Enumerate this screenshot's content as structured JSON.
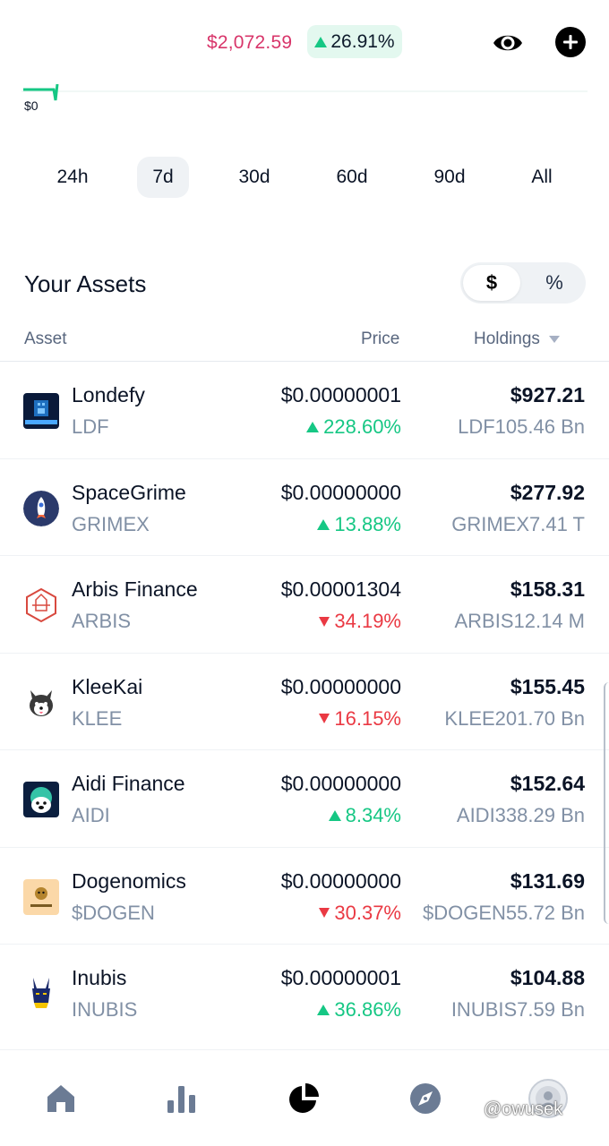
{
  "header": {
    "total_value": "$2,072.59",
    "change_percent": "26.91%",
    "change_direction": "up",
    "eye_icon": "eye-icon",
    "add_icon": "plus-circle-icon"
  },
  "chart": {
    "zero_label": "$0",
    "line_color": "#16c784"
  },
  "ranges": [
    "24h",
    "7d",
    "30d",
    "60d",
    "90d",
    "All"
  ],
  "active_range": "7d",
  "assets_section": {
    "title": "Your Assets",
    "toggle_dollar": "$",
    "toggle_percent": "%",
    "col_asset": "Asset",
    "col_price": "Price",
    "col_holdings": "Holdings"
  },
  "assets": [
    {
      "name": "Londefy",
      "symbol": "LDF",
      "price": "$0.00000001",
      "change": "228.60%",
      "direction": "up",
      "holdings": "$927.21",
      "quantity": "LDF105.46 Bn",
      "logo": "londefy-logo"
    },
    {
      "name": "SpaceGrime",
      "symbol": "GRIMEX",
      "price": "$0.00000000",
      "change": "13.88%",
      "direction": "up",
      "holdings": "$277.92",
      "quantity": "GRIMEX7.41 T",
      "logo": "rocket-logo"
    },
    {
      "name": "Arbis Finance",
      "symbol": "ARBIS",
      "price": "$0.00001304",
      "change": "34.19%",
      "direction": "down",
      "holdings": "$158.31",
      "quantity": "ARBIS12.14 M",
      "logo": "arbis-logo"
    },
    {
      "name": "KleeKai",
      "symbol": "KLEE",
      "price": "$0.00000000",
      "change": "16.15%",
      "direction": "down",
      "holdings": "$155.45",
      "quantity": "KLEE201.70 Bn",
      "logo": "husky-logo"
    },
    {
      "name": "Aidi Finance",
      "symbol": "AIDI",
      "price": "$0.00000000",
      "change": "8.34%",
      "direction": "up",
      "holdings": "$152.64",
      "quantity": "AIDI338.29 Bn",
      "logo": "aidi-logo"
    },
    {
      "name": "Dogenomics",
      "symbol": "$DOGEN",
      "price": "$0.00000000",
      "change": "30.37%",
      "direction": "down",
      "holdings": "$131.69",
      "quantity": "$DOGEN55.72 Bn",
      "logo": "dogenomics-logo"
    },
    {
      "name": "Inubis",
      "symbol": "INUBIS",
      "price": "$0.00000001",
      "change": "36.86%",
      "direction": "up",
      "holdings": "$104.88",
      "quantity": "INUBIS7.59 Bn",
      "logo": "anubis-logo"
    }
  ],
  "bottom_nav": [
    "home-icon",
    "bar-chart-icon",
    "pie-chart-icon",
    "compass-icon",
    "profile-icon"
  ],
  "watermark": "@owusek"
}
